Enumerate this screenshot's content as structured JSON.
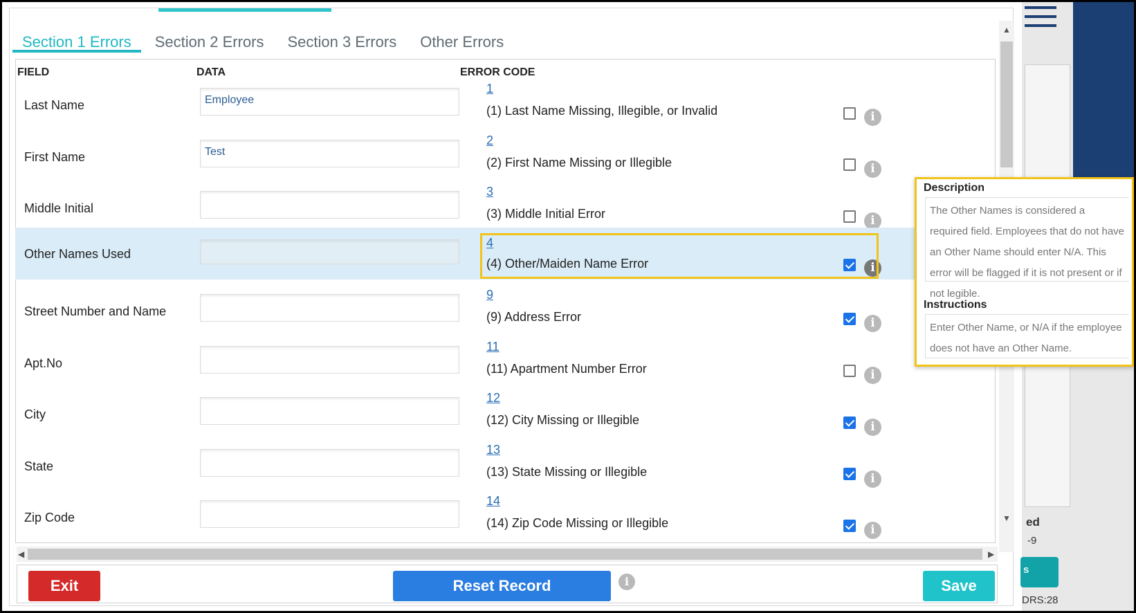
{
  "tabs": [
    {
      "label": "Section 1 Errors",
      "active": true
    },
    {
      "label": "Section 2 Errors",
      "active": false
    },
    {
      "label": "Section 3 Errors",
      "active": false
    },
    {
      "label": "Other Errors",
      "active": false
    }
  ],
  "columns": {
    "field": "FIELD",
    "data": "DATA",
    "error_code": "ERROR CODE"
  },
  "rows": [
    {
      "field": "Last Name",
      "value": "Employee",
      "code": "1",
      "error": "(1) Last Name Missing, Illegible, or Invalid",
      "checked": false
    },
    {
      "field": "First Name",
      "value": "Test",
      "code": "2",
      "error": "(2) First Name Missing or Illegible",
      "checked": false
    },
    {
      "field": "Middle Initial",
      "value": "",
      "code": "3",
      "error": "(3) Middle Initial Error",
      "checked": false
    },
    {
      "field": "Other Names Used",
      "value": "",
      "code": "4",
      "error": "(4) Other/Maiden Name Error",
      "checked": true,
      "selected": true
    },
    {
      "field": "Street Number and Name",
      "value": "",
      "code": "9",
      "error": "(9) Address Error",
      "checked": true
    },
    {
      "field": "Apt.No",
      "value": "",
      "code": "11",
      "error": "(11) Apartment Number Error",
      "checked": false
    },
    {
      "field": "City",
      "value": "",
      "code": "12",
      "error": "(12) City Missing or Illegible",
      "checked": true
    },
    {
      "field": "State",
      "value": "",
      "code": "13",
      "error": "(13) State Missing or Illegible",
      "checked": true
    },
    {
      "field": "Zip Code",
      "value": "",
      "code": "14",
      "error": "(14) Zip Code Missing or Illegible",
      "checked": true
    }
  ],
  "tooltip": {
    "description_title": "Description",
    "description": "The Other Names is considered a required field. Employees that do not have an Other Name should enter N/A. This error will be flagged if it is not present or if not legible.",
    "instructions_title": "Instructions",
    "instructions": "Enter Other Name, or N/A if the employee does not have an Other Name."
  },
  "footer": {
    "exit_label": "Exit",
    "reset_label": "Reset Record",
    "save_label": "Save"
  },
  "background": {
    "text1": "ed",
    "text2": "-9",
    "text3": "s",
    "text4": "DRS:28"
  },
  "colors": {
    "accent": "#21b8c2",
    "exit": "#d42a2a",
    "reset": "#2a7de1",
    "save": "#21c3cb",
    "highlight": "#f2c318",
    "selected_row": "#d9ecf7"
  }
}
